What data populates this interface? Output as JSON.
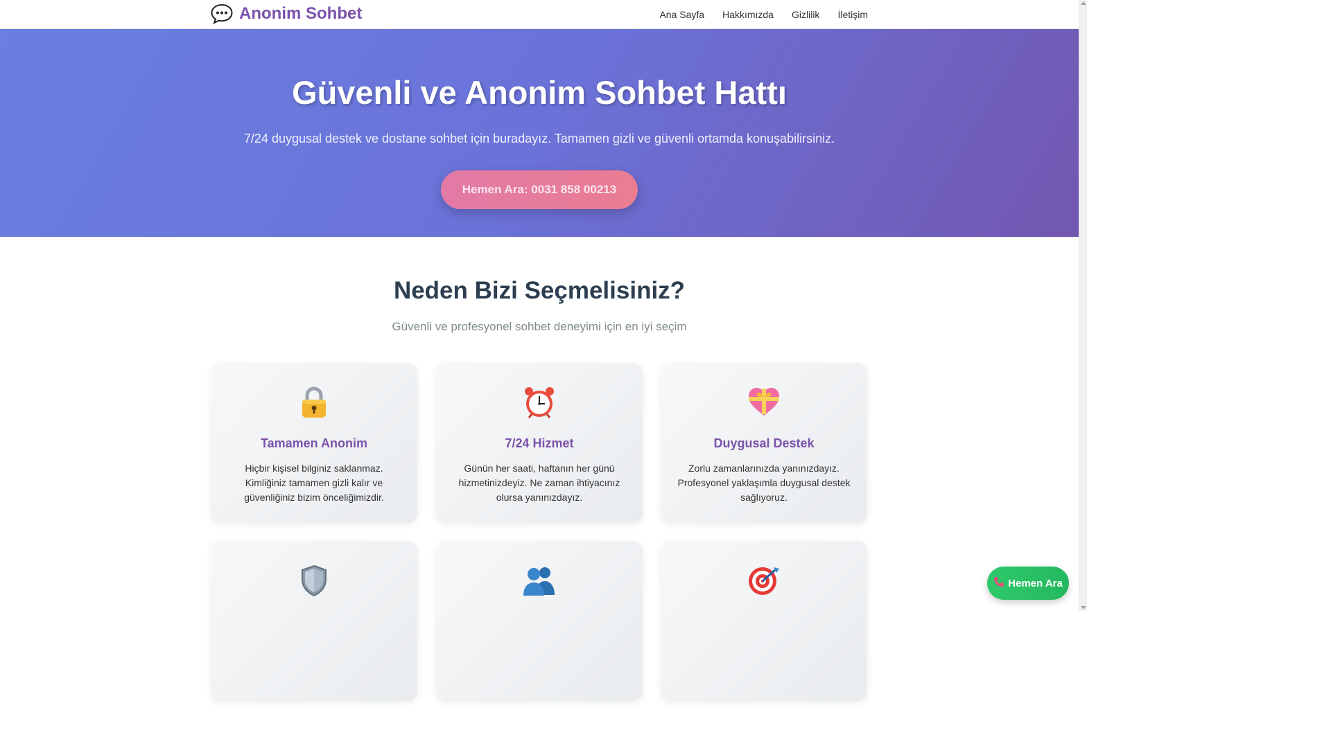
{
  "brand": {
    "name": "Anonim Sohbet",
    "icon": "speech-bubble-icon"
  },
  "nav": [
    "Ana Sayfa",
    "Hakkımızda",
    "Gizlilik",
    "İletişim"
  ],
  "hero": {
    "title": "Güvenli ve Anonim Sohbet Hattı",
    "subtitle": "7/24 duygusal destek ve dostane sohbet için buradayız. Tamamen gizli ve güvenli ortamda konuşabilirsiniz.",
    "cta": "Hemen Ara: 0031 858 00213"
  },
  "features": {
    "title": "Neden Bizi Seçmelisiniz?",
    "subtitle": "Güvenli ve profesyonel sohbet deneyimi için en iyi seçim",
    "cards": [
      {
        "icon": "lock-icon",
        "title": "Tamamen Anonim",
        "text": "Hiçbir kişisel bilginiz saklanmaz. Kimliğiniz tamamen gizli kalır ve güvenliğiniz bizim önceliğimizdir."
      },
      {
        "icon": "alarm-clock-icon",
        "title": "7/24 Hizmet",
        "text": "Günün her saati, haftanın her günü hizmetinizdeyiz. Ne zaman ihtiyacınız olursa yanınızdayız."
      },
      {
        "icon": "gift-heart-icon",
        "title": "Duygusal Destek",
        "text": "Zorlu zamanlarınızda yanınızdayız. Profesyonel yaklaşımla duygusal destek sağlıyoruz."
      },
      {
        "icon": "shield-icon",
        "title": "",
        "text": ""
      },
      {
        "icon": "people-icon",
        "title": "",
        "text": ""
      },
      {
        "icon": "target-icon",
        "title": "",
        "text": ""
      }
    ]
  },
  "floating": {
    "label": "Hemen Ara",
    "icon": "phone-icon"
  },
  "colors": {
    "brand": "#7b52ab",
    "hero_start": "#6a7fe0",
    "hero_end": "#7257b0",
    "cta": "#e27aa6",
    "float": "#2ec96b"
  }
}
